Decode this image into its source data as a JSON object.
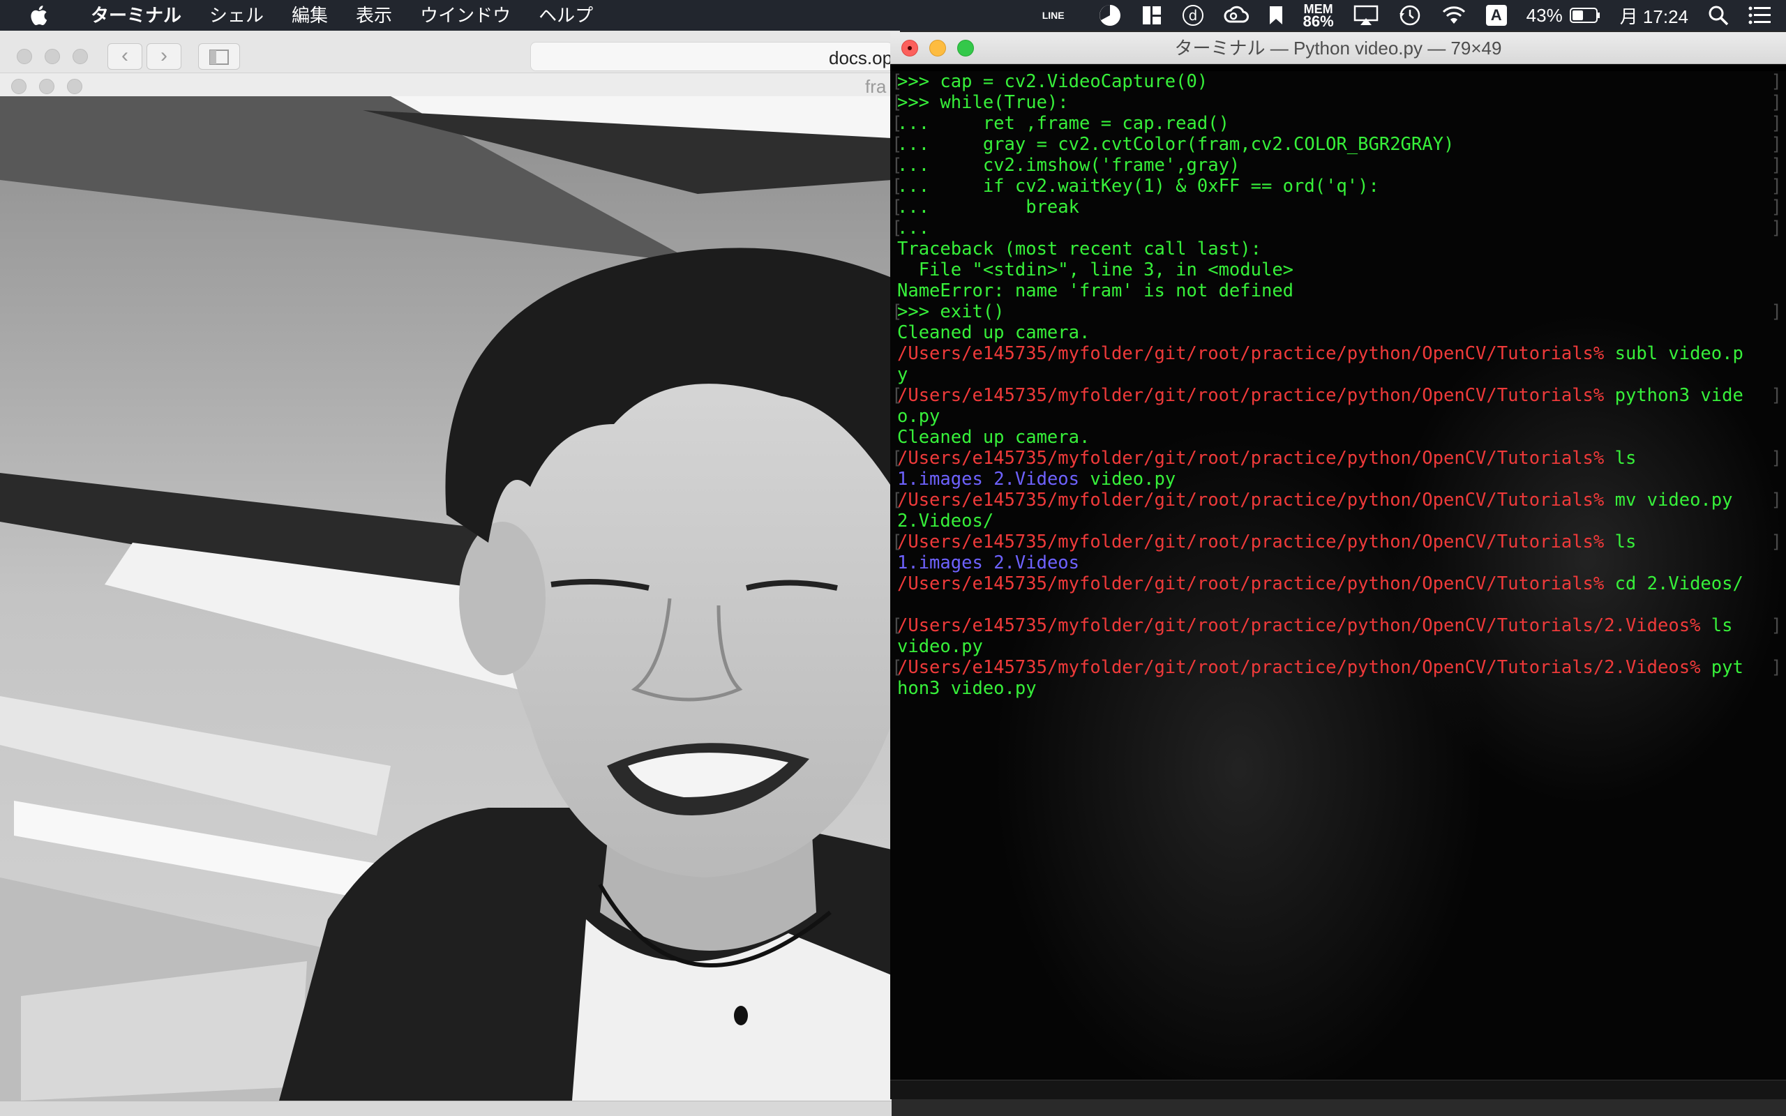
{
  "menubar": {
    "app_name": "ターミナル",
    "items": [
      "シェル",
      "編集",
      "表示",
      "ウインドウ",
      "ヘルプ"
    ],
    "status": {
      "line_label": "LINE",
      "mem_label": "MEM",
      "mem_value": "86%",
      "input_source": "A",
      "battery": "43%",
      "clock": "月 17:24"
    }
  },
  "browser": {
    "url_text": "docs.op",
    "fragment_text": "fra"
  },
  "terminal": {
    "title": "ターミナル — Python video.py — 79×49",
    "lines": [
      {
        "mark": true,
        "segments": [
          {
            "c": "green",
            "t": ">>> cap = cv2.VideoCapture(0)"
          }
        ]
      },
      {
        "mark": true,
        "segments": [
          {
            "c": "green",
            "t": ">>> while(True):"
          }
        ]
      },
      {
        "mark": true,
        "segments": [
          {
            "c": "green",
            "t": "...     ret ,frame = cap.read()"
          }
        ]
      },
      {
        "mark": true,
        "segments": [
          {
            "c": "green",
            "t": "...     gray = cv2.cvtColor(fram,cv2.COLOR_BGR2GRAY)"
          }
        ]
      },
      {
        "mark": true,
        "segments": [
          {
            "c": "green",
            "t": "...     cv2.imshow('frame',gray)"
          }
        ]
      },
      {
        "mark": true,
        "segments": [
          {
            "c": "green",
            "t": "...     if cv2.waitKey(1) & 0xFF == ord('q'):"
          }
        ]
      },
      {
        "mark": true,
        "segments": [
          {
            "c": "green",
            "t": "...         break"
          }
        ]
      },
      {
        "mark": true,
        "segments": [
          {
            "c": "green",
            "t": "..."
          }
        ]
      },
      {
        "mark": false,
        "segments": [
          {
            "c": "green",
            "t": "Traceback (most recent call last):"
          }
        ]
      },
      {
        "mark": false,
        "segments": [
          {
            "c": "green",
            "t": "  File \"<stdin>\", line 3, in <module>"
          }
        ]
      },
      {
        "mark": false,
        "segments": [
          {
            "c": "green",
            "t": "NameError: name 'fram' is not defined"
          }
        ]
      },
      {
        "mark": true,
        "segments": [
          {
            "c": "green",
            "t": ">>> exit()"
          }
        ]
      },
      {
        "mark": false,
        "segments": [
          {
            "c": "green",
            "t": "Cleaned up camera."
          }
        ]
      },
      {
        "mark": false,
        "segments": [
          {
            "c": "red",
            "t": "/Users/e145735/myfolder/git/root/practice/python/OpenCV/Tutorials% "
          },
          {
            "c": "green",
            "t": "subl video.p"
          }
        ]
      },
      {
        "mark": false,
        "segments": [
          {
            "c": "green",
            "t": "y"
          }
        ]
      },
      {
        "mark": true,
        "segments": [
          {
            "c": "red",
            "t": "/Users/e145735/myfolder/git/root/practice/python/OpenCV/Tutorials% "
          },
          {
            "c": "green",
            "t": "python3 vide"
          }
        ]
      },
      {
        "mark": false,
        "segments": [
          {
            "c": "green",
            "t": "o.py"
          }
        ]
      },
      {
        "mark": false,
        "segments": [
          {
            "c": "green",
            "t": "Cleaned up camera."
          }
        ]
      },
      {
        "mark": true,
        "segments": [
          {
            "c": "red",
            "t": "/Users/e145735/myfolder/git/root/practice/python/OpenCV/Tutorials% "
          },
          {
            "c": "green",
            "t": "ls"
          }
        ]
      },
      {
        "mark": false,
        "segments": [
          {
            "c": "blue",
            "t": "1.images"
          },
          {
            "c": "green",
            "t": " "
          },
          {
            "c": "blue",
            "t": "2.Videos"
          },
          {
            "c": "green",
            "t": " video.py"
          }
        ]
      },
      {
        "mark": true,
        "segments": [
          {
            "c": "red",
            "t": "/Users/e145735/myfolder/git/root/practice/python/OpenCV/Tutorials% "
          },
          {
            "c": "green",
            "t": "mv video.py "
          }
        ]
      },
      {
        "mark": false,
        "segments": [
          {
            "c": "green",
            "t": "2.Videos/"
          }
        ]
      },
      {
        "mark": true,
        "segments": [
          {
            "c": "red",
            "t": "/Users/e145735/myfolder/git/root/practice/python/OpenCV/Tutorials% "
          },
          {
            "c": "green",
            "t": "ls"
          }
        ]
      },
      {
        "mark": false,
        "segments": [
          {
            "c": "blue",
            "t": "1.images"
          },
          {
            "c": "green",
            "t": " "
          },
          {
            "c": "blue",
            "t": "2.Videos"
          }
        ]
      },
      {
        "mark": false,
        "segments": [
          {
            "c": "red",
            "t": "/Users/e145735/myfolder/git/root/practice/python/OpenCV/Tutorials% "
          },
          {
            "c": "green",
            "t": "cd 2.Videos/"
          }
        ]
      },
      {
        "mark": false,
        "segments": [
          {
            "c": "green",
            "t": ""
          }
        ]
      },
      {
        "mark": true,
        "segments": [
          {
            "c": "red",
            "t": "/Users/e145735/myfolder/git/root/practice/python/OpenCV/Tutorials/2.Videos% "
          },
          {
            "c": "green",
            "t": "ls"
          }
        ]
      },
      {
        "mark": false,
        "segments": [
          {
            "c": "green",
            "t": "video.py"
          }
        ]
      },
      {
        "mark": true,
        "segments": [
          {
            "c": "red",
            "t": "/Users/e145735/myfolder/git/root/practice/python/OpenCV/Tutorials/2.Videos% "
          },
          {
            "c": "green",
            "t": "pyt"
          }
        ]
      },
      {
        "mark": false,
        "segments": [
          {
            "c": "green",
            "t": "hon3 video.py"
          }
        ]
      }
    ],
    "colors": {
      "green": "#37f03a",
      "red": "#ef3a3a",
      "blue": "#6e62ff",
      "background": "#050505"
    }
  },
  "icons": {
    "menubar_left": [
      "apple-icon"
    ],
    "menubar_right": [
      "line-icon",
      "pie-clock-icon",
      "window-layout-icon",
      "d-circle-icon",
      "creative-cloud-icon",
      "bookmark-icon",
      "memory-monitor-icon",
      "airplay-icon",
      "time-machine-icon",
      "wifi-icon",
      "input-source-icon",
      "battery-icon",
      "spotlight-icon",
      "notification-center-icon"
    ]
  }
}
